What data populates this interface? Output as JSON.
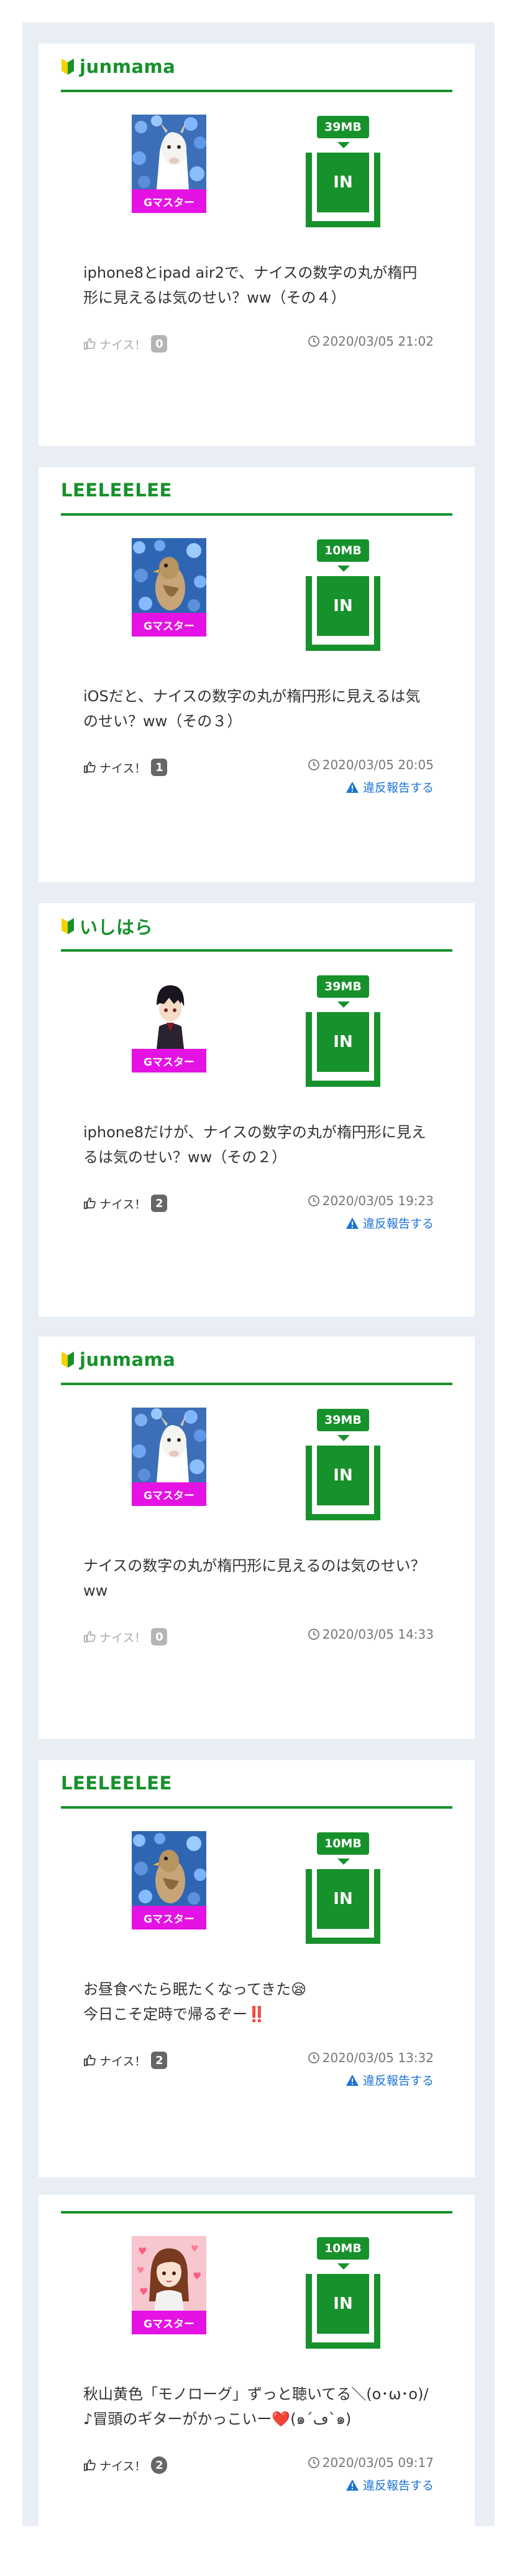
{
  "colors": {
    "accent": "#17912b",
    "badge": "#e413e4",
    "link": "#1b73d6",
    "muted": "#777777"
  },
  "posts": [
    {
      "user": "junmama",
      "beginner_icon": true,
      "avatar": "goat-flowers",
      "badge": "Gマスター",
      "size": "39MB",
      "in_label": "IN",
      "message": "iphone8とipad air2で、ナイスの数字の丸が楕円形に見えるは気のせい？ww（その４）",
      "nice_label": "ナイス！",
      "nice_count": "0",
      "nice_active": false,
      "timestamp": "2020/03/05 21:02",
      "report_label": null
    },
    {
      "user": "LEELEELEE",
      "beginner_icon": false,
      "avatar": "bird-flowers",
      "badge": "Gマスター",
      "size": "10MB",
      "in_label": "IN",
      "message": "iOSだと、ナイスの数字の丸が楕円形に見えるは気のせい？ww（その３）",
      "nice_label": "ナイス！",
      "nice_count": "1",
      "nice_active": true,
      "timestamp": "2020/03/05 20:05",
      "report_label": "違反報告する"
    },
    {
      "user": "いしはら",
      "beginner_icon": true,
      "avatar": "anime-boy",
      "badge": "Gマスター",
      "size": "39MB",
      "in_label": "IN",
      "message": "iphone8だけが、ナイスの数字の丸が楕円形に見えるは気のせい？ww（その２）",
      "nice_label": "ナイス！",
      "nice_count": "2",
      "nice_active": true,
      "timestamp": "2020/03/05 19:23",
      "report_label": "違反報告する"
    },
    {
      "user": "junmama",
      "beginner_icon": true,
      "avatar": "goat-flowers",
      "badge": "Gマスター",
      "size": "39MB",
      "in_label": "IN",
      "message": "ナイスの数字の丸が楕円形に見えるのは気のせい？ww",
      "nice_label": "ナイス！",
      "nice_count": "0",
      "nice_active": false,
      "timestamp": "2020/03/05 14:33",
      "report_label": null
    },
    {
      "user": "LEELEELEE",
      "beginner_icon": false,
      "avatar": "bird-flowers",
      "badge": "Gマスター",
      "size": "10MB",
      "in_label": "IN",
      "message": "お昼食べたら眠たくなってきた😪\n今日こそ定時で帰るぞー‼️",
      "nice_label": "ナイス！",
      "nice_count": "2",
      "nice_active": true,
      "timestamp": "2020/03/05 13:32",
      "report_label": "違反報告する"
    },
    {
      "user": "",
      "beginner_icon": false,
      "avatar": "anime-girl-hearts",
      "badge": "Gマスター",
      "size": "10MB",
      "in_label": "IN",
      "message": "秋山黄色「モノローグ」ずっと聴いてる＼(o･ω･o)/♪冒頭のギターがかっこいー❤️(๑´ڡ`๑)",
      "nice_label": "ナイス！",
      "nice_count": "2",
      "nice_active": true,
      "timestamp": "2020/03/05 09:17",
      "report_label": "違反報告する"
    }
  ]
}
